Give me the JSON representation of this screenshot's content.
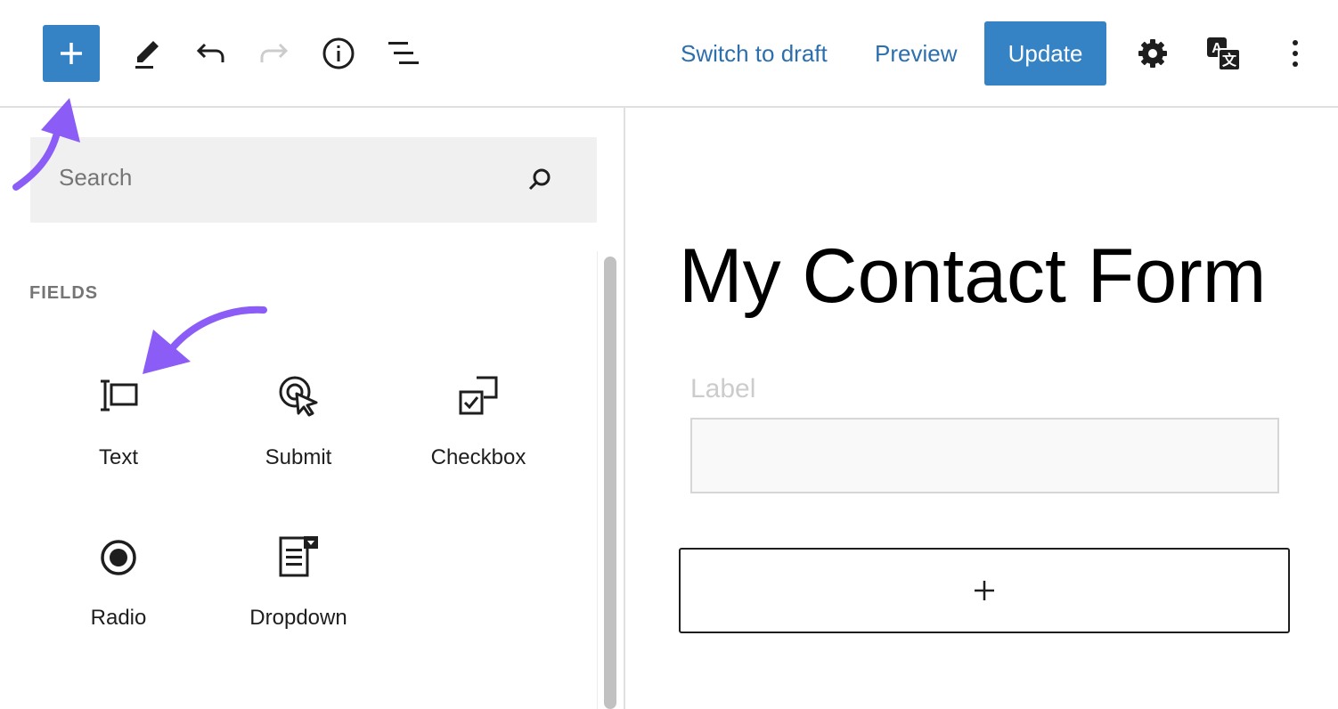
{
  "toolbar": {
    "switch_to_draft": "Switch to draft",
    "preview": "Preview",
    "update": "Update",
    "icons": [
      "plus-icon",
      "pen-icon",
      "undo-icon",
      "redo-icon",
      "info-icon",
      "list-view-icon",
      "gear-icon",
      "translate-icon",
      "more-vertical-icon"
    ]
  },
  "inserter": {
    "search_placeholder": "Search",
    "section_title": "FIELDS",
    "blocks": [
      {
        "label": "Text",
        "icon": "text-field-icon"
      },
      {
        "label": "Submit",
        "icon": "submit-cursor-icon"
      },
      {
        "label": "Checkbox",
        "icon": "checkbox-icon"
      },
      {
        "label": "Radio",
        "icon": "radio-icon"
      },
      {
        "label": "Dropdown",
        "icon": "dropdown-icon"
      }
    ]
  },
  "editor": {
    "title": "My Contact Form",
    "field_label": "Label"
  },
  "colors": {
    "accent": "#3582c4",
    "link": "#2d6fad",
    "annotation": "#8b5cf6"
  }
}
